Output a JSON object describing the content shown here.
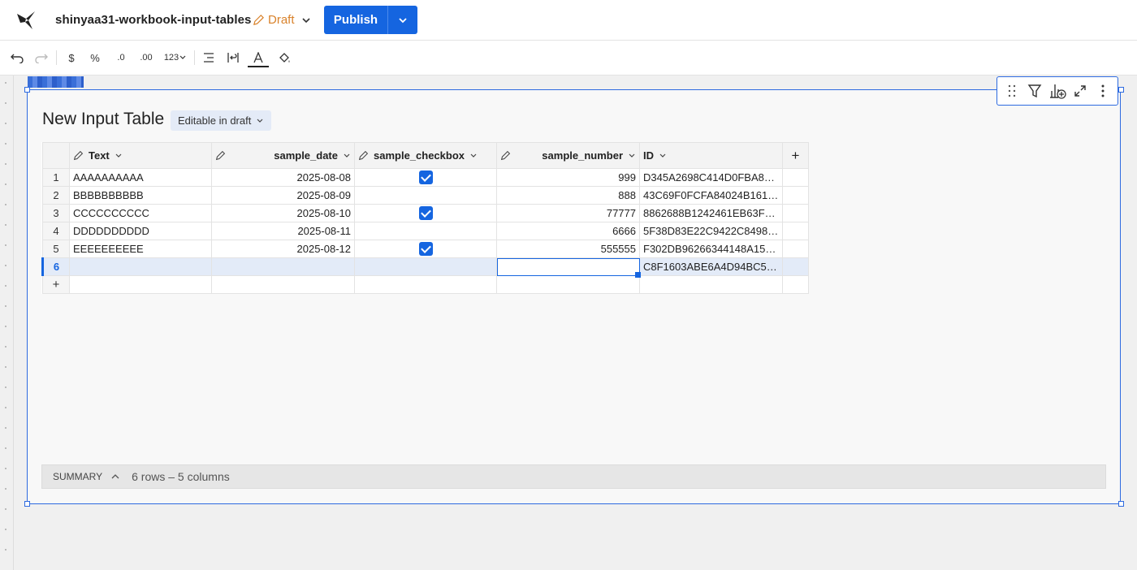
{
  "header": {
    "workbook_title": "shinyaa31-workbook-input-tables",
    "draft_label": "Draft",
    "publish_label": "Publish"
  },
  "toolbar": {
    "currency": "$",
    "percent": "%",
    "decrease_decimals": ".0",
    "increase_decimals": ".00",
    "number_format": "123"
  },
  "table": {
    "title": "New Input Table",
    "badge": "Editable in draft",
    "columns": [
      "Text",
      "sample_date",
      "sample_checkbox",
      "sample_number",
      "ID"
    ],
    "rows": [
      {
        "n": "1",
        "text": "AAAAAAAAAA",
        "date": "2025-08-08",
        "checked": true,
        "number": "999",
        "id": "D345A2698C414D0FBA8B…"
      },
      {
        "n": "2",
        "text": "BBBBBBBBBB",
        "date": "2025-08-09",
        "checked": false,
        "number": "888",
        "id": "43C69F0FCFA84024B161…"
      },
      {
        "n": "3",
        "text": "CCCCCCCCCC",
        "date": "2025-08-10",
        "checked": true,
        "number": "77777",
        "id": "8862688B1242461EB63F…"
      },
      {
        "n": "4",
        "text": "DDDDDDDDDD",
        "date": "2025-08-11",
        "checked": false,
        "number": "6666",
        "id": "5F38D83E22C9422C8498…"
      },
      {
        "n": "5",
        "text": "EEEEEEEEEE",
        "date": "2025-08-12",
        "checked": true,
        "number": "555555",
        "id": "F302DB96266344148A15…"
      },
      {
        "n": "6",
        "text": "",
        "date": "",
        "checked": false,
        "number": "",
        "id": "C8F1603ABE6A4D94BC55…"
      }
    ],
    "add_row": "+",
    "add_column": "+"
  },
  "summary": {
    "label": "SUMMARY",
    "info": "6 rows – 5 columns"
  },
  "colors": {
    "accent": "#1565e0",
    "draft": "#d9822b"
  }
}
